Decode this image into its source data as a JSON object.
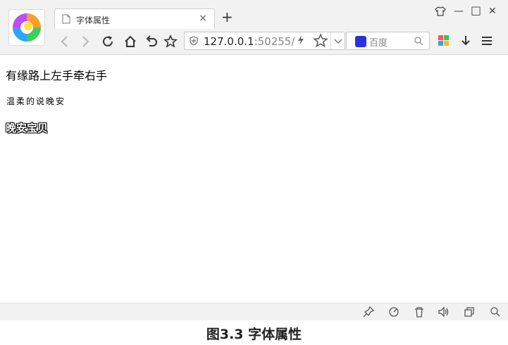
{
  "browser": {
    "tab": {
      "title": "字体属性",
      "close": "×"
    },
    "new_tab": "+",
    "window_controls": {
      "skin": "shirt-icon",
      "minimize": "—",
      "maximize": "□",
      "close": "✕"
    },
    "address": {
      "host": "127.0.0.1",
      "port": ":50255/"
    },
    "search": {
      "engine": "百度"
    }
  },
  "page": {
    "lines": [
      "有缘路上左手牵右手",
      "温柔的说晚安",
      "晚安宝贝"
    ]
  },
  "caption": "图3.3  字体属性",
  "colors": {
    "chrome_bg": "#f2f2f2",
    "search_brand": "#2932e1"
  }
}
